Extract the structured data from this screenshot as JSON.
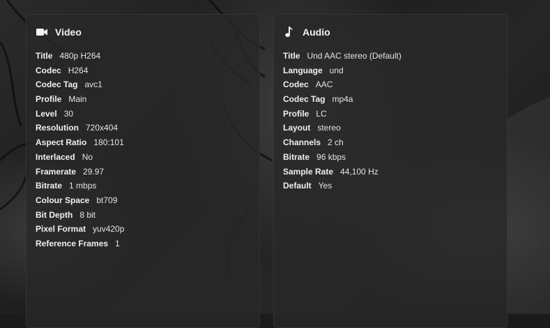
{
  "video": {
    "title": "Video",
    "icon": "video-camera-icon",
    "rows": [
      {
        "key": "Title",
        "value": "480p H264"
      },
      {
        "key": "Codec",
        "value": "H264"
      },
      {
        "key": "Codec Tag",
        "value": "avc1"
      },
      {
        "key": "Profile",
        "value": "Main"
      },
      {
        "key": "Level",
        "value": "30"
      },
      {
        "key": "Resolution",
        "value": "720x404"
      },
      {
        "key": "Aspect Ratio",
        "value": "180:101"
      },
      {
        "key": "Interlaced",
        "value": "No"
      },
      {
        "key": "Framerate",
        "value": "29.97"
      },
      {
        "key": "Bitrate",
        "value": "1 mbps"
      },
      {
        "key": "Colour Space",
        "value": "bt709"
      },
      {
        "key": "Bit Depth",
        "value": "8 bit"
      },
      {
        "key": "Pixel Format",
        "value": "yuv420p"
      },
      {
        "key": "Reference Frames",
        "value": "1"
      }
    ]
  },
  "audio": {
    "title": "Audio",
    "icon": "music-note-icon",
    "rows": [
      {
        "key": "Title",
        "value": "Und AAC stereo (Default)"
      },
      {
        "key": "Language",
        "value": "und"
      },
      {
        "key": "Codec",
        "value": "AAC"
      },
      {
        "key": "Codec Tag",
        "value": "mp4a"
      },
      {
        "key": "Profile",
        "value": "LC"
      },
      {
        "key": "Layout",
        "value": "stereo"
      },
      {
        "key": "Channels",
        "value": "2 ch"
      },
      {
        "key": "Bitrate",
        "value": "96 kbps"
      },
      {
        "key": "Sample Rate",
        "value": "44,100 Hz"
      },
      {
        "key": "Default",
        "value": "Yes"
      }
    ]
  }
}
